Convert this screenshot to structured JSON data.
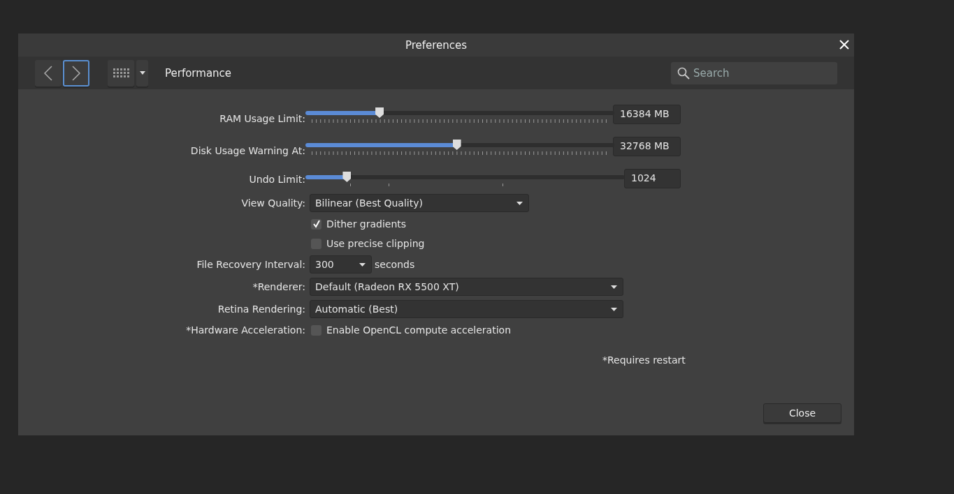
{
  "window": {
    "title": "Preferences"
  },
  "toolbar": {
    "back_selected": false,
    "forward_selected": true,
    "section": "Performance",
    "search": {
      "placeholder": "Search"
    }
  },
  "sliders": [
    {
      "label": "RAM Usage Limit:",
      "kind": "dense",
      "level": 0.24,
      "value": "16384 MB"
    },
    {
      "label": "Disk Usage Warning At:",
      "kind": "dense",
      "level": 0.49,
      "value": "32768 MB"
    },
    {
      "label": "Undo Limit:",
      "kind": "sparse",
      "level": 0.13,
      "value": "1024"
    }
  ],
  "view_quality": {
    "label": "View Quality:",
    "value": "Bilinear (Best Quality)"
  },
  "checkboxes": [
    {
      "label": "Dither gradients",
      "checked": true
    },
    {
      "label": "Use precise clipping",
      "checked": false
    }
  ],
  "file_recovery": {
    "label": "File Recovery Interval:",
    "value": "300",
    "unit": "seconds"
  },
  "renderer": {
    "label": "*Renderer:",
    "value": "Default (Radeon RX 5500 XT)"
  },
  "retina": {
    "label": "Retina Rendering:",
    "value": "Automatic (Best)"
  },
  "hardware": {
    "label": "*Hardware Acceleration:",
    "option": "Enable OpenCL compute acceleration",
    "checked": false
  },
  "note": "*Requires restart",
  "buttons": [
    "Close"
  ]
}
